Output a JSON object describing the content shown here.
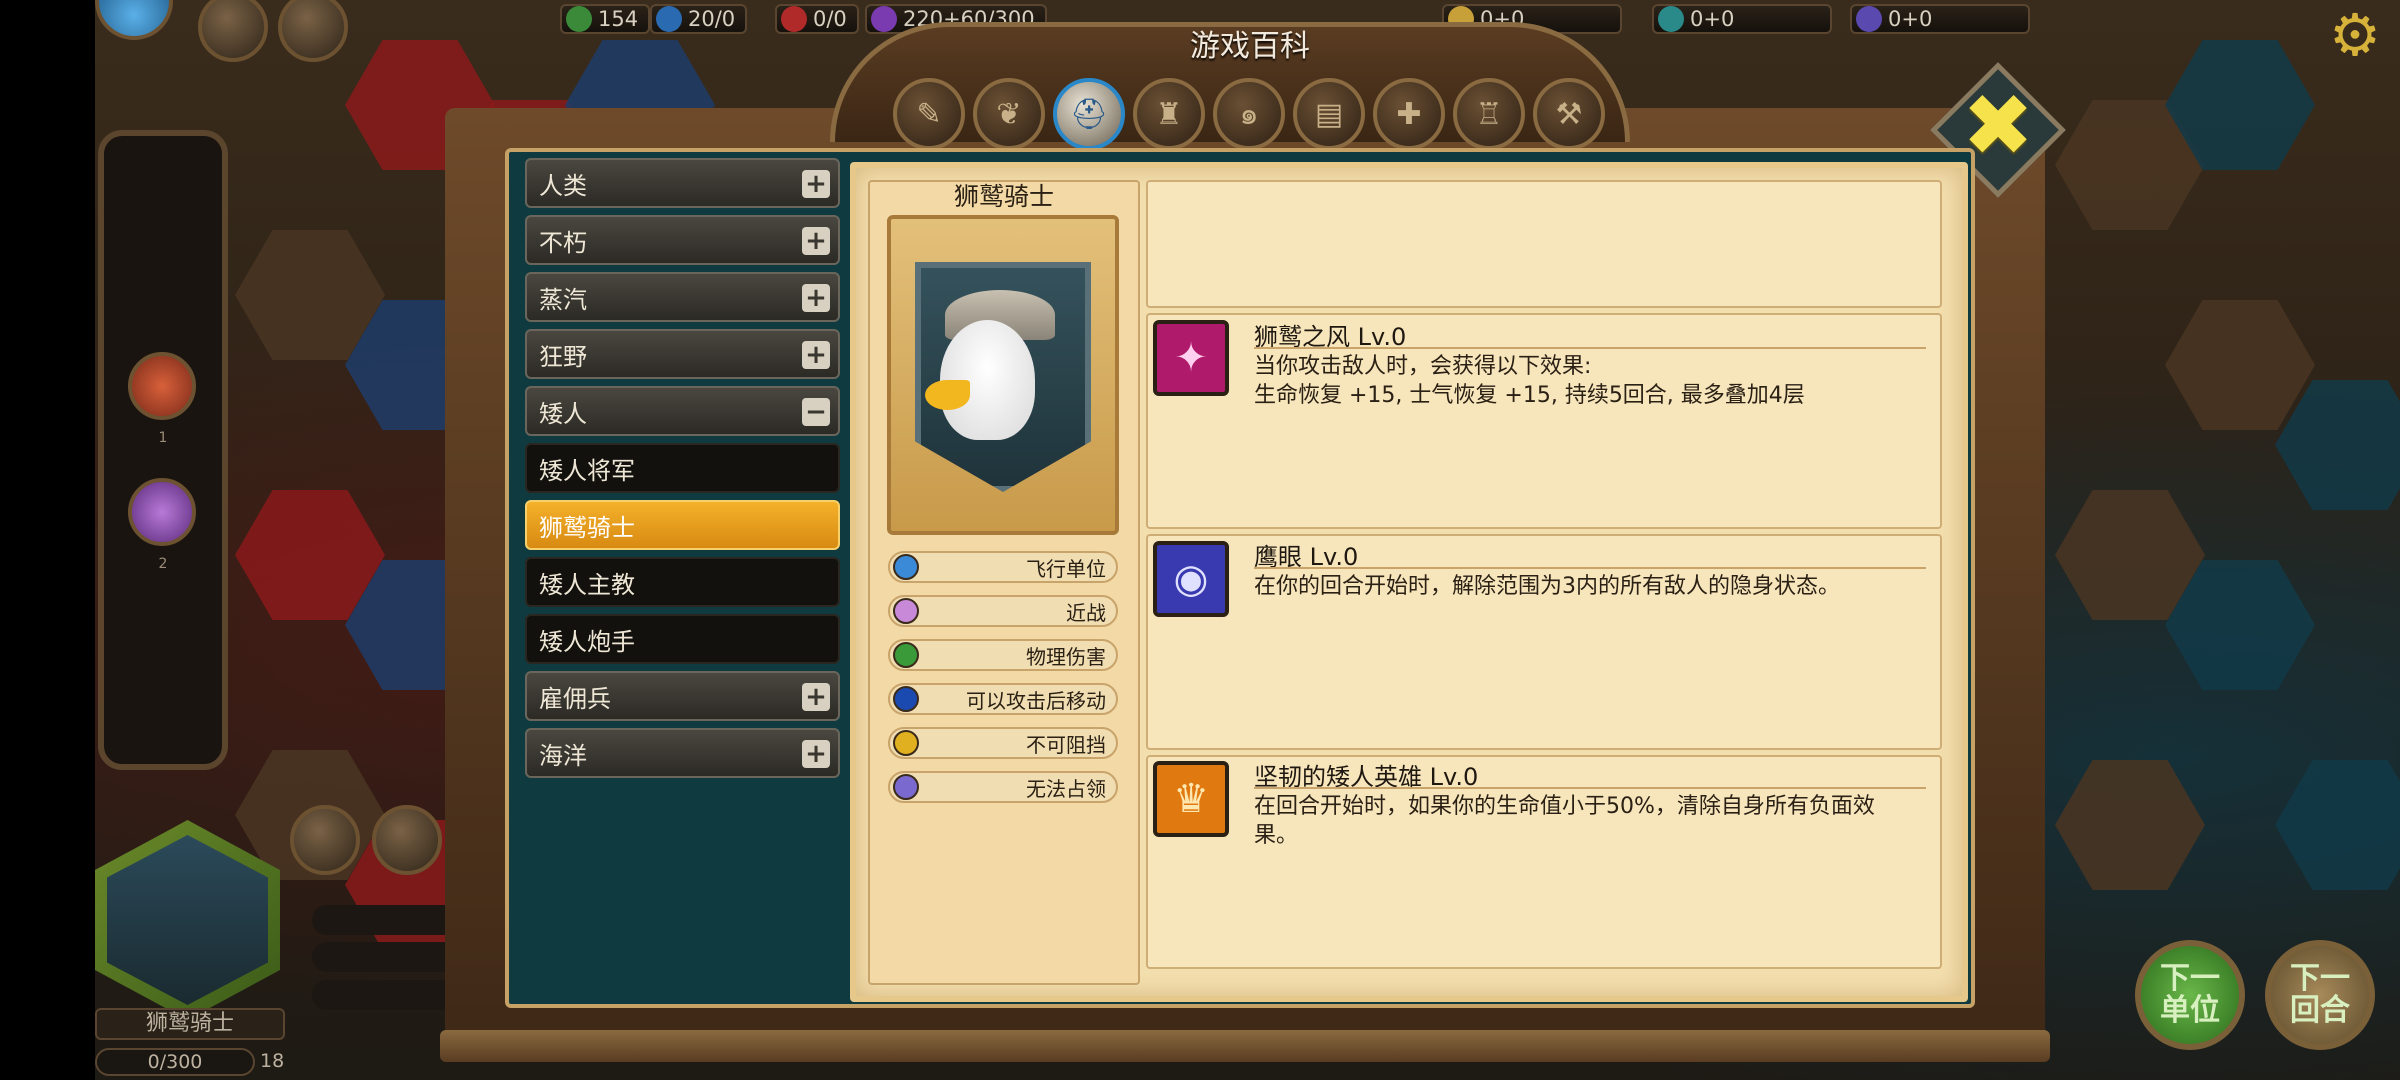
{
  "resources": [
    {
      "icon": "food-icon",
      "value": "154",
      "color": "#3a8a3a"
    },
    {
      "icon": "population-icon",
      "value": "20/0",
      "color": "#2a6ab0"
    },
    {
      "icon": "morale-icon",
      "value": "0/0",
      "color": "#b02a2a"
    },
    {
      "icon": "magic-icon",
      "value": "220+60/300",
      "color": "#7a3ab0"
    },
    {
      "icon": "gold-icon",
      "value": "0+0",
      "color": "#c8a03a"
    },
    {
      "icon": "crystal-icon",
      "value": "0+0",
      "color": "#2a8a8a"
    },
    {
      "icon": "mana-icon",
      "value": "0+0",
      "color": "#5a4ab0"
    }
  ],
  "panel": {
    "title": "游戏百科",
    "tabs": [
      "scroll-icon",
      "feather-icon",
      "helmet-icon",
      "armor-icon",
      "swirl-icon",
      "book-icon",
      "sword-icon",
      "tower-icon",
      "hammer-icon"
    ],
    "active_tab": 2
  },
  "categories": [
    {
      "label": "人类",
      "type": "group",
      "toggle": "+"
    },
    {
      "label": "不朽",
      "type": "group",
      "toggle": "+"
    },
    {
      "label": "蒸汽",
      "type": "group",
      "toggle": "+"
    },
    {
      "label": "狂野",
      "type": "group",
      "toggle": "+"
    },
    {
      "label": "矮人",
      "type": "group",
      "toggle": "−"
    },
    {
      "label": "矮人将军",
      "type": "child"
    },
    {
      "label": "狮鹫骑士",
      "type": "selected"
    },
    {
      "label": "矮人主教",
      "type": "child"
    },
    {
      "label": "矮人炮手",
      "type": "child"
    },
    {
      "label": "雇佣兵",
      "type": "group",
      "toggle": "+"
    },
    {
      "label": "海洋",
      "type": "group",
      "toggle": "+"
    }
  ],
  "unit": {
    "name": "狮鹫骑士",
    "tags": [
      {
        "label": "飞行单位",
        "icon": "flying-icon",
        "color": "#3a8ad8"
      },
      {
        "label": "近战",
        "icon": "melee-icon",
        "color": "#c88ad8"
      },
      {
        "label": "物理伤害",
        "icon": "physical-damage-icon",
        "color": "#3a9a3a"
      },
      {
        "label": "可以攻击后移动",
        "icon": "move-after-attack-icon",
        "color": "#1a4ab0"
      },
      {
        "label": "不可阻挡",
        "icon": "unstoppable-icon",
        "color": "#e0b020"
      },
      {
        "label": "无法占领",
        "icon": "cannot-capture-icon",
        "color": "#7a6ad0"
      }
    ]
  },
  "skills": [
    {
      "title": "狮鹫之风 Lv.0",
      "icon": "wind-icon",
      "bg": "#b01a6a",
      "desc": [
        "当你攻击敌人时，会获得以下效果:",
        "生命恢复 +15, 士气恢复 +15, 持续5回合, 最多叠加4层"
      ]
    },
    {
      "title": "鹰眼 Lv.0",
      "icon": "eagle-eye-icon",
      "bg": "#3a3ab0",
      "desc": [
        "在你的回合开始时，解除范围为3内的所有敌人的隐身状态。"
      ]
    },
    {
      "title": "坚韧的矮人英雄 Lv.0",
      "icon": "dwarf-hero-icon",
      "bg": "#e07a10",
      "desc": [
        "在回合开始时，如果你的生命值小于50%，清除自身所有负面效",
        "果。"
      ]
    }
  ],
  "hero": {
    "name": "狮鹫骑士",
    "hp": "0/300",
    "level": "18"
  },
  "rail": {
    "count1": "1",
    "count2": "2"
  },
  "buttons": {
    "next_unit": "下一\n单位",
    "next_turn": "下一\n回合"
  }
}
